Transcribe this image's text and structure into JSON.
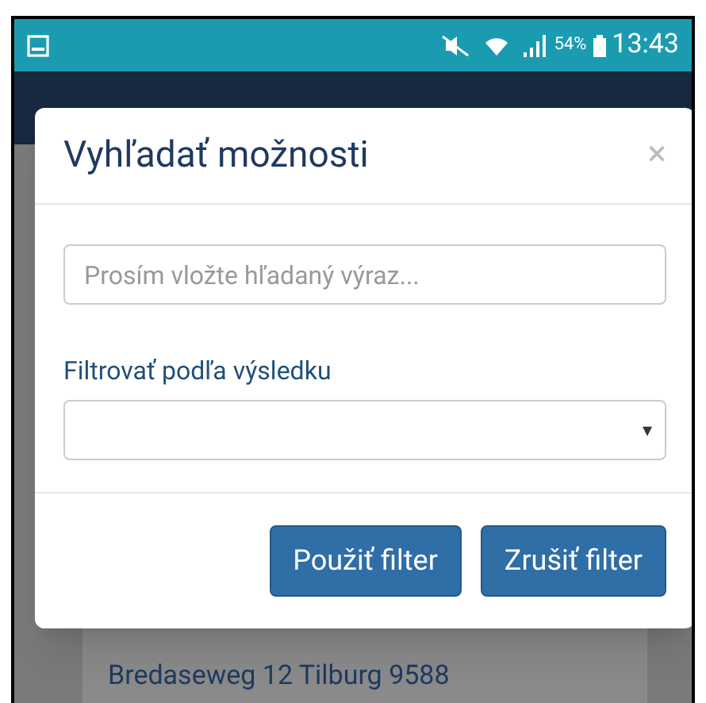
{
  "status_bar": {
    "battery_percent": "54%",
    "time": "13:43"
  },
  "dialog": {
    "title": "Vyhľadať možnosti",
    "close": "×",
    "search": {
      "placeholder": "Prosím vložte hľadaný výraz..."
    },
    "filter": {
      "label": "Filtrovať podľa výsledku",
      "caret": "▾"
    },
    "buttons": [
      {
        "label": "Použiť filter"
      },
      {
        "label": "Zrušiť filter"
      }
    ]
  },
  "background": {
    "address": "Bredaseweg 12 Tilburg 9588"
  }
}
